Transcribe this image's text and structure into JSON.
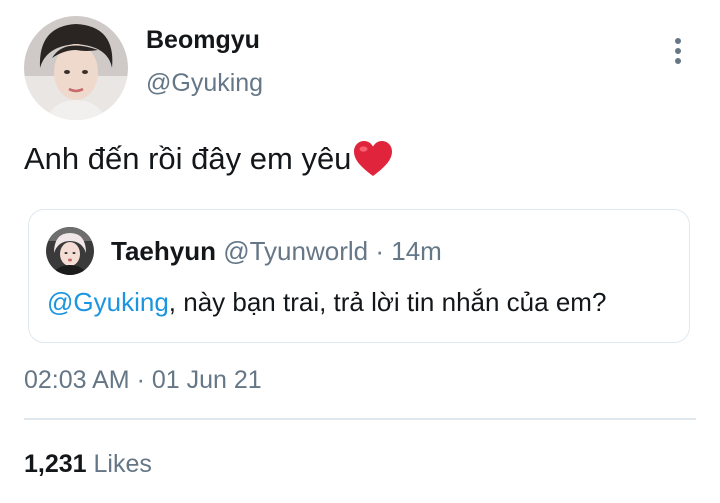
{
  "author": {
    "display_name": "Beomgyu",
    "handle": "@Gyuking"
  },
  "tweet": {
    "text": "Anh đến rồi đây em yêu",
    "emoji": "red-heart",
    "timestamp": "02:03 AM · 01 Jun 21"
  },
  "quoted_tweet": {
    "display_name": "Taehyun",
    "handle": "@Tyunworld",
    "separator": "·",
    "time": "14m",
    "mention": "@Gyuking",
    "body": ", này bạn trai, trả lời tin nhắn của em?"
  },
  "stats": {
    "likes_count": "1,231",
    "likes_label": "Likes"
  },
  "icons": {
    "more": "more-vertical-icon"
  },
  "colors": {
    "link": "#1b95e0",
    "secondary_text": "#657786",
    "primary_text": "#14171a",
    "border": "#e1e8ed",
    "heart": "#e0243c"
  }
}
